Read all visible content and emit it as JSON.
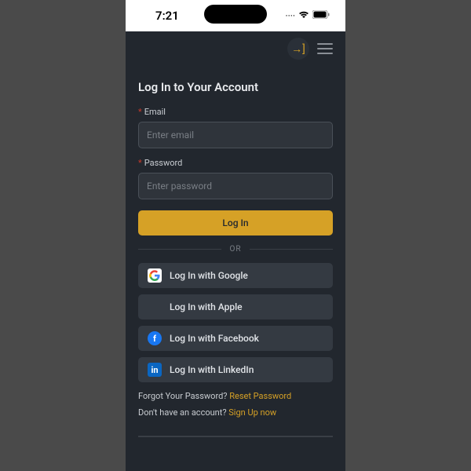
{
  "status": {
    "time": "7:21"
  },
  "page": {
    "title": "Log In to Your Account",
    "email_label": "Email",
    "email_placeholder": "Enter email",
    "password_label": "Password",
    "password_placeholder": "Enter password",
    "login_button": "Log In",
    "or_label": "OR",
    "social": {
      "google": "Log In with Google",
      "apple": "Log In with Apple",
      "facebook": "Log In with Facebook",
      "linkedin": "Log In with LinkedIn"
    },
    "forgot_prompt": "Forgot Your Password? ",
    "forgot_link": "Reset Password",
    "signup_prompt": "Don't have an account? ",
    "signup_link": "Sign Up now"
  },
  "colors": {
    "accent": "#d6a126",
    "bg": "#22272e"
  }
}
